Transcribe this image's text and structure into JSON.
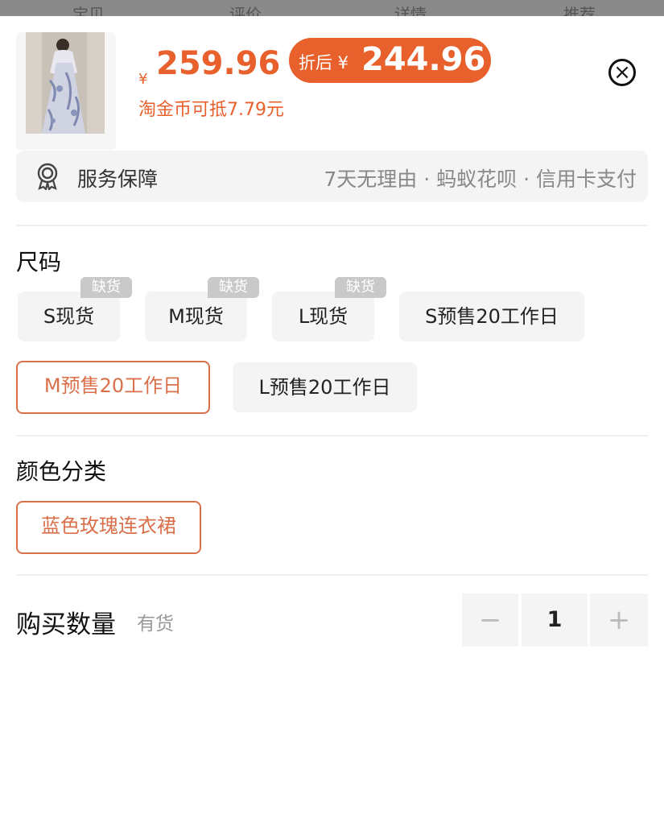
{
  "backdrop": {
    "tabs": [
      "宝贝",
      "评价",
      "详情",
      "推荐"
    ]
  },
  "header": {
    "currency": "¥",
    "price": "259.96",
    "discount_label": "折后 ¥",
    "discount_price": "244.96",
    "coin_note": "淘金币可抵7.79元",
    "close_icon": "×"
  },
  "service": {
    "icon": "shield-badge-icon",
    "title": "服务保障",
    "desc": "7天无理由 · 蚂蚁花呗 · 信用卡支付"
  },
  "size": {
    "title": "尺码",
    "options": [
      {
        "label": "S现货",
        "tag": "缺货"
      },
      {
        "label": "M现货",
        "tag": "缺货"
      },
      {
        "label": "L现货",
        "tag": "缺货"
      },
      {
        "label": "S预售20工作日",
        "tag": ""
      },
      {
        "label": "M预售20工作日",
        "tag": "",
        "selected": true
      },
      {
        "label": "L预售20工作日",
        "tag": ""
      }
    ]
  },
  "color": {
    "title": "颜色分类",
    "options": [
      {
        "label": "蓝色玫瑰连衣裙",
        "selected": true
      }
    ]
  },
  "quantity": {
    "label": "购买数量",
    "stock": "有货",
    "minus": "−",
    "value": "1",
    "plus": "+"
  },
  "colors": {
    "accent": "#e8612c",
    "selected_border": "#d9704a"
  }
}
